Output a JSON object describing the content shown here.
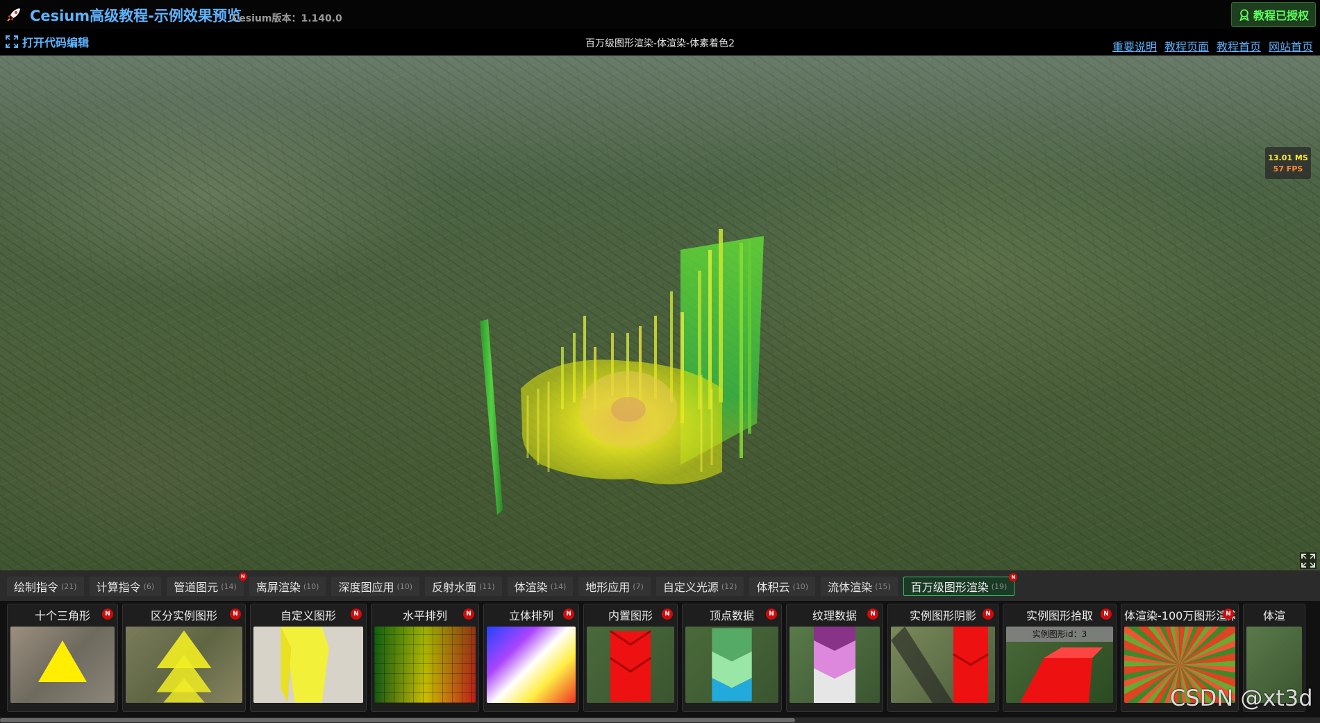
{
  "header": {
    "title": "Cesium高级教程-示例效果预览",
    "version": "Cesium版本：1.140.0",
    "auth": "教程已授权"
  },
  "subbar": {
    "code_edit": "打开代码编辑",
    "subtitle": "百万级图形渲染-体渲染-体素着色2",
    "links": [
      "重要说明",
      "教程页面",
      "教程首页",
      "网站首页"
    ]
  },
  "perf": {
    "ms": "13.01 MS",
    "fps": "57 FPS"
  },
  "tabs": [
    {
      "label": "绘制指令",
      "count": "(21)",
      "new": false
    },
    {
      "label": "计算指令",
      "count": "(6)",
      "new": false
    },
    {
      "label": "管道图元",
      "count": "(14)",
      "new": true
    },
    {
      "label": "离屏渲染",
      "count": "(10)",
      "new": false
    },
    {
      "label": "深度图应用",
      "count": "(10)",
      "new": false
    },
    {
      "label": "反射水面",
      "count": "(11)",
      "new": false
    },
    {
      "label": "体渲染",
      "count": "(14)",
      "new": false
    },
    {
      "label": "地形应用",
      "count": "(7)",
      "new": false
    },
    {
      "label": "自定义光源",
      "count": "(12)",
      "new": false
    },
    {
      "label": "体积云",
      "count": "(10)",
      "new": false
    },
    {
      "label": "流体渲染",
      "count": "(15)",
      "new": false
    },
    {
      "label": "百万级图形渲染",
      "count": "(19)",
      "new": true,
      "active": true
    }
  ],
  "new_badge": "N",
  "thumbs": [
    {
      "label": "十个三角形"
    },
    {
      "label": "区分实例图形"
    },
    {
      "label": "自定义图形"
    },
    {
      "label": "水平排列"
    },
    {
      "label": "立体排列"
    },
    {
      "label": "内置图形"
    },
    {
      "label": "顶点数据"
    },
    {
      "label": "纹理数据"
    },
    {
      "label": "实例图形阴影"
    },
    {
      "label": "实例图形拾取",
      "overlay": "实例图形id：3"
    },
    {
      "label": "体渲染-100万图形渲染"
    },
    {
      "label": "体渲"
    }
  ],
  "watermark": "CSDN @xt3d",
  "colors": {
    "accent": "#5fb4ff",
    "auth_green": "#5dff5d",
    "new_red": "#d10a0a",
    "active_tab_border": "#34c26a"
  }
}
